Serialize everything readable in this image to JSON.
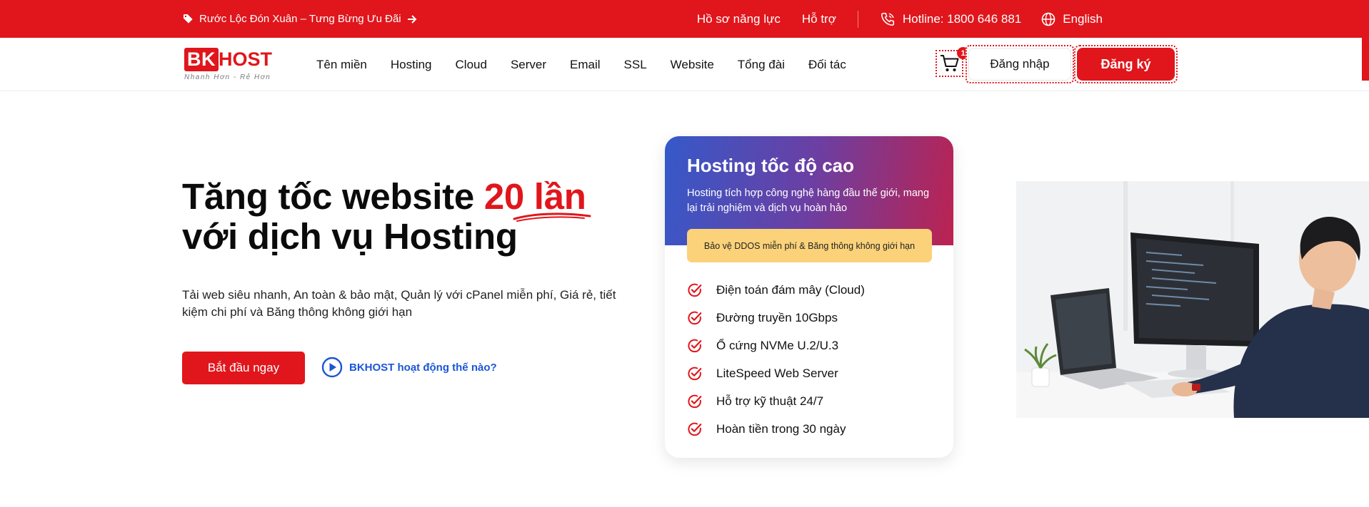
{
  "topbar": {
    "promo_text": "Rước Lộc Đón Xuân – Tưng Bừng Ưu Đãi",
    "links": [
      "Hồ sơ năng lực",
      "Hỗ trợ"
    ],
    "hotline": "Hotline: 1800 646 881",
    "language": "English"
  },
  "header": {
    "logo_bk": "BK",
    "logo_host": "HOST",
    "logo_slogan": "Nhanh Hơn - Rẻ Hơn",
    "nav": [
      "Tên miền",
      "Hosting",
      "Cloud",
      "Server",
      "Email",
      "SSL",
      "Website",
      "Tổng đài",
      "Đối tác"
    ],
    "cart_count": "1",
    "login_label": "Đăng nhập",
    "register_label": "Đăng ký"
  },
  "hero": {
    "title_part1": "Tăng tốc website ",
    "title_highlight": "20 lần",
    "title_line2": "với dịch vụ Hosting",
    "description": "Tải web siêu nhanh, An toàn & bảo mật, Quản lý với cPanel miễn phí, Giá rẻ, tiết kiệm chi phí và Băng thông không giới hạn",
    "start_button": "Bắt đầu ngay",
    "how_link": "BKHOST hoạt động thế nào?"
  },
  "card": {
    "title": "Hosting tốc độ cao",
    "subtitle": "Hosting tích hợp công nghệ hàng đầu thế giới, mang lại trải nghiệm và dịch vụ hoàn hảo",
    "pill": "Bảo vệ DDOS miễn phí & Băng thông không giới hạn",
    "features": [
      "Điện toán đám mây (Cloud)",
      "Đường truyền 10Gbps",
      "Ổ cứng NVMe U.2/U.3",
      "LiteSpeed Web Server",
      "Hỗ trợ kỹ thuật 24/7",
      "Hoàn tiền trong 30 ngày"
    ]
  },
  "colors": {
    "brand_red": "#e0161c",
    "link_blue": "#1a56d6",
    "pill_yellow": "#fbd27a"
  },
  "icons": [
    "tag-icon",
    "arrow-right-icon",
    "phone-icon",
    "globe-icon",
    "cart-icon",
    "play-circle-icon",
    "check-circle-icon"
  ]
}
